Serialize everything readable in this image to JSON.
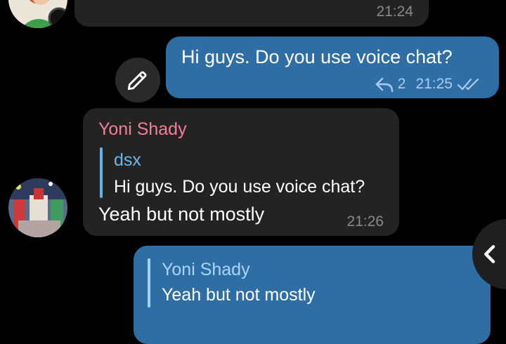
{
  "messages": [
    {
      "id": "msg1",
      "direction": "incoming",
      "time": "21:24"
    },
    {
      "id": "msg2",
      "direction": "outgoing",
      "text": "Hi guys. Do you use voice chat?",
      "reply_count": "2",
      "time": "21:25"
    },
    {
      "id": "msg3",
      "direction": "incoming",
      "sender": "Yoni Shady",
      "quote_author": "dsx",
      "quote_text": "Hi guys. Do you use voice chat?",
      "text": "Yeah but not mostly",
      "time": "21:26"
    },
    {
      "id": "msg4",
      "direction": "outgoing",
      "quote_author": "Yoni Shady",
      "quote_text": "Yeah but not mostly"
    }
  ],
  "colors": {
    "background": "#000000",
    "incoming_bubble": "#232323",
    "outgoing_bubble": "#2f6ea5",
    "sender_name": "#f07f9a",
    "quote_author_in": "#6ab8f0",
    "quote_author_out": "#a8d6ff"
  },
  "icons": {
    "edit": "pencil-icon",
    "reply_count": "reply-arrow-icon",
    "read_status": "double-check-icon",
    "back": "chevron-left-icon"
  }
}
